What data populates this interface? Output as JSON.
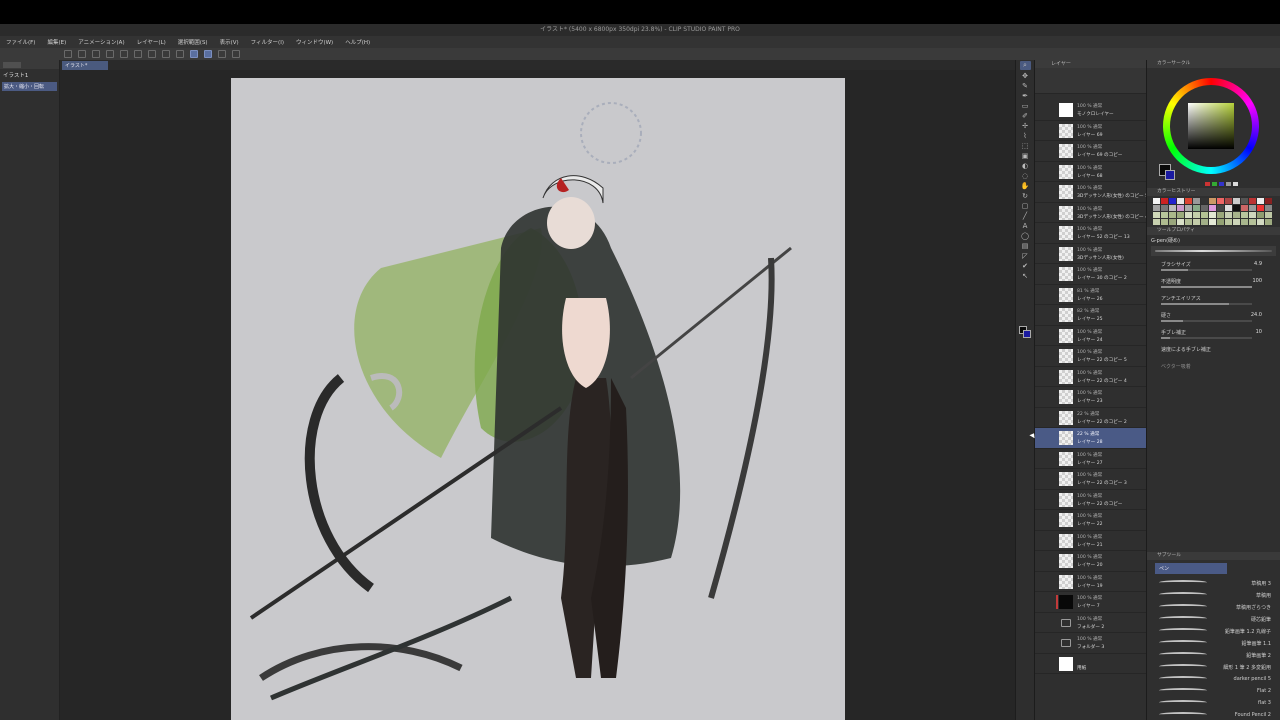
{
  "window": {
    "title": "イラスト* (5400 x 6800px 350dpi 23.8%) - CLIP STUDIO PAINT PRO"
  },
  "menu": [
    "ファイル(F)",
    "編集(E)",
    "アニメーション(A)",
    "レイヤー(L)",
    "選択範囲(S)",
    "表示(V)",
    "フィルター(I)",
    "ウィンドウ(W)",
    "ヘルプ(H)"
  ],
  "left_panel": {
    "title": "イラスト1",
    "item": "拡大・縮小・回転"
  },
  "document_tab": "イラスト*",
  "layer_panel": {
    "title": "レイヤー",
    "layers": [
      {
        "blend": "100 % 通常",
        "name": "モノクロレイヤー",
        "thumb": "white"
      },
      {
        "blend": "100 % 通常",
        "name": "レイヤー 69",
        "thumb": "check"
      },
      {
        "blend": "100 % 通常",
        "name": "レイヤー 69 のコピー",
        "thumb": "check"
      },
      {
        "blend": "100 % 通常",
        "name": "レイヤー 68",
        "thumb": "check"
      },
      {
        "blend": "100 % 通常",
        "name": "3Dデッサン人形(女性) のコピー 5",
        "thumb": "check"
      },
      {
        "blend": "100 % 通常",
        "name": "3Dデッサン人形(女性) のコピー 4",
        "thumb": "check"
      },
      {
        "blend": "100 % 通常",
        "name": "レイヤー 52 のコピー 13",
        "thumb": "check"
      },
      {
        "blend": "100 % 通常",
        "name": "3Dデッサン人形(女性)",
        "thumb": "check"
      },
      {
        "blend": "100 % 通常",
        "name": "レイヤー 30 のコピー 2",
        "thumb": "check"
      },
      {
        "blend": "81 % 通常",
        "name": "レイヤー 26",
        "thumb": "check"
      },
      {
        "blend": "82 % 通常",
        "name": "レイヤー 25",
        "thumb": "check"
      },
      {
        "blend": "100 % 通常",
        "name": "レイヤー 24",
        "thumb": "check"
      },
      {
        "blend": "100 % 通常",
        "name": "レイヤー 22 のコピー 5",
        "thumb": "check"
      },
      {
        "blend": "100 % 通常",
        "name": "レイヤー 22 のコピー 4",
        "thumb": "check"
      },
      {
        "blend": "100 % 通常",
        "name": "レイヤー 23",
        "thumb": "check"
      },
      {
        "blend": "22 % 通常",
        "name": "レイヤー 22 のコピー 2",
        "thumb": "check"
      },
      {
        "blend": "22 % 通常",
        "name": "レイヤー 28",
        "thumb": "check",
        "selected": true
      },
      {
        "blend": "100 % 通常",
        "name": "レイヤー 27",
        "thumb": "check"
      },
      {
        "blend": "100 % 通常",
        "name": "レイヤー 22 のコピー 3",
        "thumb": "check"
      },
      {
        "blend": "100 % 通常",
        "name": "レイヤー 22 のコピー",
        "thumb": "check"
      },
      {
        "blend": "100 % 通常",
        "name": "レイヤー 22",
        "thumb": "check"
      },
      {
        "blend": "100 % 通常",
        "name": "レイヤー 21",
        "thumb": "check"
      },
      {
        "blend": "100 % 通常",
        "name": "レイヤー 20",
        "thumb": "check"
      },
      {
        "blend": "100 % 通常",
        "name": "レイヤー 19",
        "thumb": "check"
      },
      {
        "blend": "100 % 通常",
        "name": "レイヤー 7",
        "thumb": "dark"
      },
      {
        "blend": "100 % 通常",
        "name": "フォルダー 2",
        "thumb": "folder"
      },
      {
        "blend": "100 % 通常",
        "name": "フォルダー 3",
        "thumb": "folder"
      },
      {
        "blend": "",
        "name": "用紙",
        "thumb": "white"
      }
    ]
  },
  "right_panel": {
    "color_wheel_title": "カラーサークル",
    "color_history_title": "カラーヒストリー",
    "tool_property_title": "ツールプロパティ",
    "brush_name": "G-pen(硬め)",
    "props": [
      {
        "label": "ブラシサイズ",
        "value": "4.9",
        "level": 0.3
      },
      {
        "label": "不透明度",
        "value": "100",
        "level": 1.0
      },
      {
        "label": "アンチエイリアス",
        "value": "",
        "level": 0.75
      },
      {
        "label": "硬さ",
        "value": "24.0",
        "level": 0.24
      },
      {
        "label": "手ブレ補正",
        "value": "10",
        "level": 0.1
      }
    ],
    "checkbox_label": "速度による手ブレ補正",
    "vector_label": "ベクター吸着",
    "subtool_title": "サブツール",
    "subtool_group": "ペン",
    "brushes": [
      "草稿用 3",
      "草稿用",
      "草稿用ざらつき",
      "硬芯鉛筆",
      "鉛筆画筆 1.2 丸線子",
      "鉛筆画筆 1.1",
      "鉛筆画筆 2",
      "細形 1 筆 2 多変鉛用",
      "darker pencil 5",
      "Flat 2",
      "flat 3",
      "Found Pencil 2"
    ]
  },
  "colors": {
    "accent": "#4a5a86",
    "fg": "#0a0a0a",
    "bg": "#1a1aa0"
  }
}
